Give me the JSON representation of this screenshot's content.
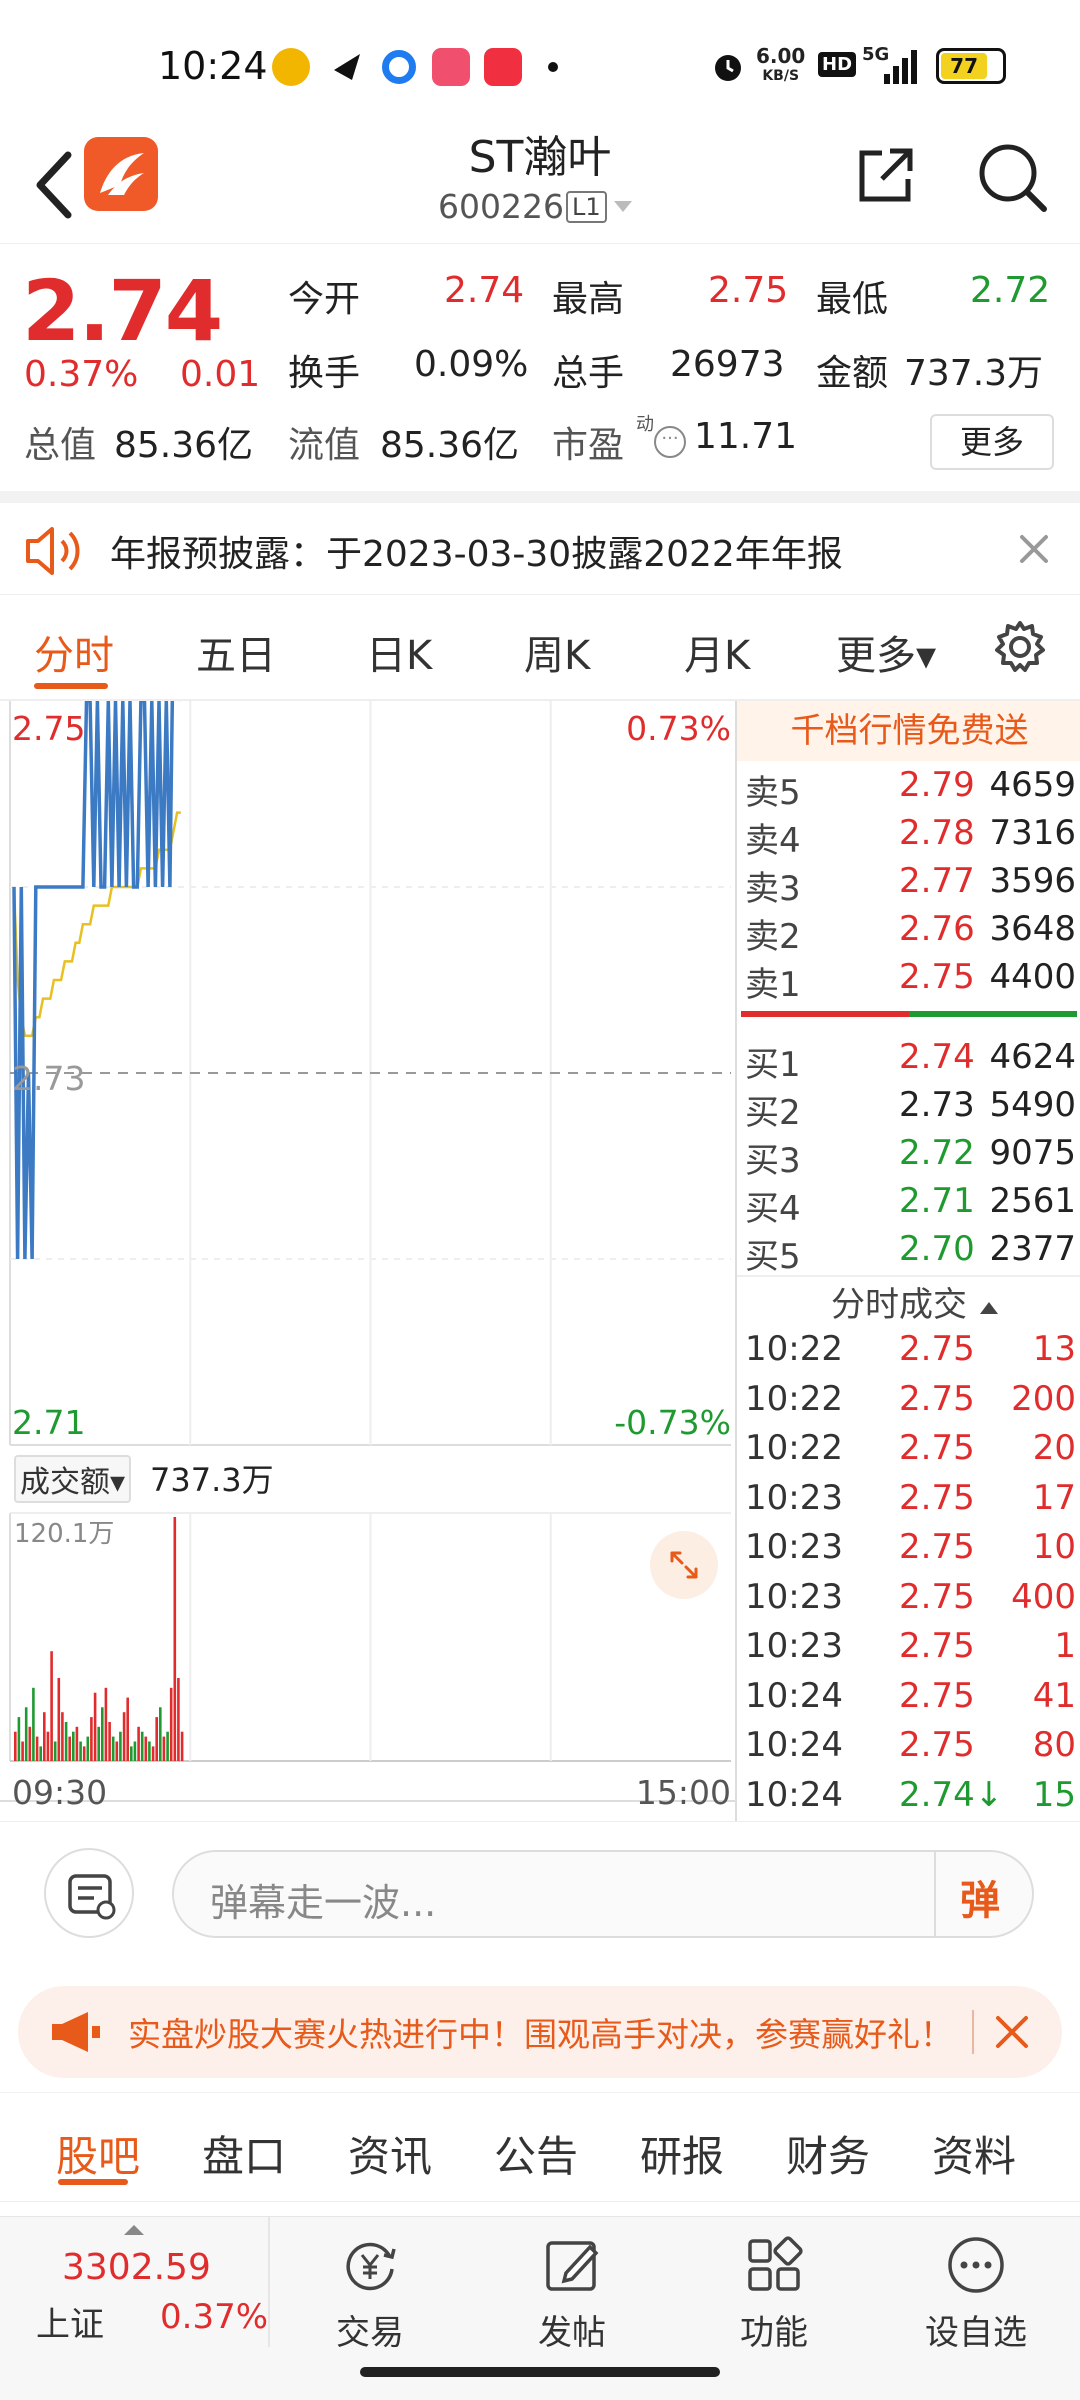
{
  "status_bar": {
    "time": "10:24",
    "net_speed": "6.00",
    "net_speed_unit": "KB/S",
    "hd": "HD",
    "signal": "5G",
    "battery": "77"
  },
  "header": {
    "stock_name": "ST瀚叶",
    "stock_code": "600226",
    "level_badge": "L1"
  },
  "quote": {
    "price": "2.74",
    "change_pct": "0.37%",
    "change": "0.01",
    "fields": {
      "open_label": "今开",
      "open": "2.74",
      "high_label": "最高",
      "high": "2.75",
      "low_label": "最低",
      "low": "2.72",
      "turnover_label": "换手",
      "turnover": "0.09%",
      "volume_label": "总手",
      "volume": "26973",
      "amount_label": "金额",
      "amount": "737.3万",
      "mktcap_label": "总值",
      "mktcap": "85.36亿",
      "float_label": "流值",
      "float": "85.36亿",
      "pe_label": "市盈",
      "pe_sup": "动",
      "pe": "11.71"
    },
    "more_button": "更多"
  },
  "notice": {
    "text": "年报预披露：于2023-03-30披露2022年年报"
  },
  "tabs": [
    {
      "label": "分时",
      "active": true
    },
    {
      "label": "五日"
    },
    {
      "label": "日K"
    },
    {
      "label": "周K"
    },
    {
      "label": "月K"
    },
    {
      "label": "更多▾"
    }
  ],
  "chart_data": {
    "type": "line",
    "price_axis": {
      "top": "2.75",
      "bottom": "2.71",
      "mid": "2.73",
      "top_pct": "0.73%",
      "bottom_pct": "-0.73%"
    },
    "ylim": [
      2.71,
      2.75
    ],
    "price_series": [
      2.74,
      2.72,
      2.74,
      2.72,
      2.73,
      2.72,
      2.74,
      2.74,
      2.74,
      2.74,
      2.74,
      2.74,
      2.74,
      2.74,
      2.74,
      2.74,
      2.74,
      2.74,
      2.74,
      2.74,
      2.75,
      2.75,
      2.74,
      2.75,
      2.74,
      2.74,
      2.75,
      2.74,
      2.75,
      2.74,
      2.75,
      2.74,
      2.75,
      2.74,
      2.74,
      2.75,
      2.75,
      2.74,
      2.75,
      2.74,
      2.75,
      2.74,
      2.75,
      2.74,
      2.755,
      2.755,
      2.75
    ],
    "avg_series": [
      2.74,
      2.735,
      2.733,
      2.732,
      2.732,
      2.732,
      2.733,
      2.733,
      2.734,
      2.734,
      2.734,
      2.735,
      2.735,
      2.735,
      2.736,
      2.736,
      2.736,
      2.737,
      2.737,
      2.738,
      2.738,
      2.738,
      2.739,
      2.739,
      2.739,
      2.739,
      2.739,
      2.74,
      2.74,
      2.74,
      2.74,
      2.74,
      2.74,
      2.74,
      2.74,
      2.741,
      2.741,
      2.741,
      2.741,
      2.741,
      2.742,
      2.742,
      2.742,
      2.742,
      2.743,
      2.744,
      2.744
    ],
    "volume_label": "成交额▾",
    "volume_total": "737.3万",
    "volume_max_label": "120.1万",
    "volume_bars": [
      12,
      18,
      8,
      22,
      14,
      30,
      10,
      6,
      20,
      12,
      45,
      8,
      34,
      20,
      16,
      10,
      12,
      14,
      8,
      6,
      10,
      18,
      28,
      14,
      22,
      30,
      16,
      10,
      8,
      12,
      20,
      26,
      6,
      8,
      14,
      12,
      10,
      8,
      6,
      18,
      22,
      10,
      12,
      30,
      100,
      34,
      12
    ],
    "volume_colors": [
      "r",
      "g",
      "r",
      "g",
      "r",
      "g",
      "r",
      "g",
      "r",
      "r",
      "r",
      "g",
      "r",
      "r",
      "g",
      "r",
      "g",
      "r",
      "g",
      "r",
      "g",
      "r",
      "r",
      "g",
      "g",
      "r",
      "r",
      "g",
      "r",
      "g",
      "r",
      "r",
      "g",
      "g",
      "r",
      "g",
      "r",
      "g",
      "r",
      "r",
      "g",
      "r",
      "g",
      "r",
      "r",
      "r",
      "r"
    ],
    "time_start": "09:30",
    "time_end": "15:00"
  },
  "orderbook": {
    "header": "千档行情免费送",
    "asks": [
      {
        "label": "卖5",
        "price": "2.79",
        "qty": "4659"
      },
      {
        "label": "卖4",
        "price": "2.78",
        "qty": "7316"
      },
      {
        "label": "卖3",
        "price": "2.77",
        "qty": "3596"
      },
      {
        "label": "卖2",
        "price": "2.76",
        "qty": "3648"
      },
      {
        "label": "卖1",
        "price": "2.75",
        "qty": "4400"
      }
    ],
    "bids": [
      {
        "label": "买1",
        "price": "2.74",
        "qty": "4624",
        "color": "red"
      },
      {
        "label": "买2",
        "price": "2.73",
        "qty": "5490",
        "color": "dark"
      },
      {
        "label": "买3",
        "price": "2.72",
        "qty": "9075",
        "color": "green"
      },
      {
        "label": "买4",
        "price": "2.71",
        "qty": "2561",
        "color": "green"
      },
      {
        "label": "买5",
        "price": "2.70",
        "qty": "2377",
        "color": "green"
      }
    ],
    "ticks_title": "分时成交",
    "ticks": [
      {
        "time": "10:22",
        "price": "2.75",
        "qty": "13"
      },
      {
        "time": "10:22",
        "price": "2.75",
        "qty": "200"
      },
      {
        "time": "10:22",
        "price": "2.75",
        "qty": "20"
      },
      {
        "time": "10:23",
        "price": "2.75",
        "qty": "17"
      },
      {
        "time": "10:23",
        "price": "2.75",
        "qty": "10"
      },
      {
        "time": "10:23",
        "price": "2.75",
        "qty": "400"
      },
      {
        "time": "10:23",
        "price": "2.75",
        "qty": "1"
      },
      {
        "time": "10:24",
        "price": "2.75",
        "qty": "41"
      },
      {
        "time": "10:24",
        "price": "2.75",
        "qty": "80"
      },
      {
        "time": "10:24",
        "price": "2.74↓",
        "qty": "15",
        "green": true
      }
    ]
  },
  "danmaku": {
    "placeholder": "弹幕走一波...",
    "button": "弹"
  },
  "promo": {
    "text": "实盘炒股大赛火热进行中！围观高手对决，参赛赢好礼！"
  },
  "subnav": [
    "股吧",
    "盘口",
    "资讯",
    "公告",
    "研报",
    "财务",
    "资料"
  ],
  "bottom": {
    "index_value": "3302.59",
    "index_name": "上证",
    "index_pct": "0.37%",
    "items": [
      "交易",
      "发帖",
      "功能",
      "设自选"
    ]
  },
  "colors": {
    "up": "#e02c2c",
    "down": "#1f9a31",
    "accent": "#e85a1a",
    "line": "#3c7ac4",
    "avg": "#e8c020"
  }
}
